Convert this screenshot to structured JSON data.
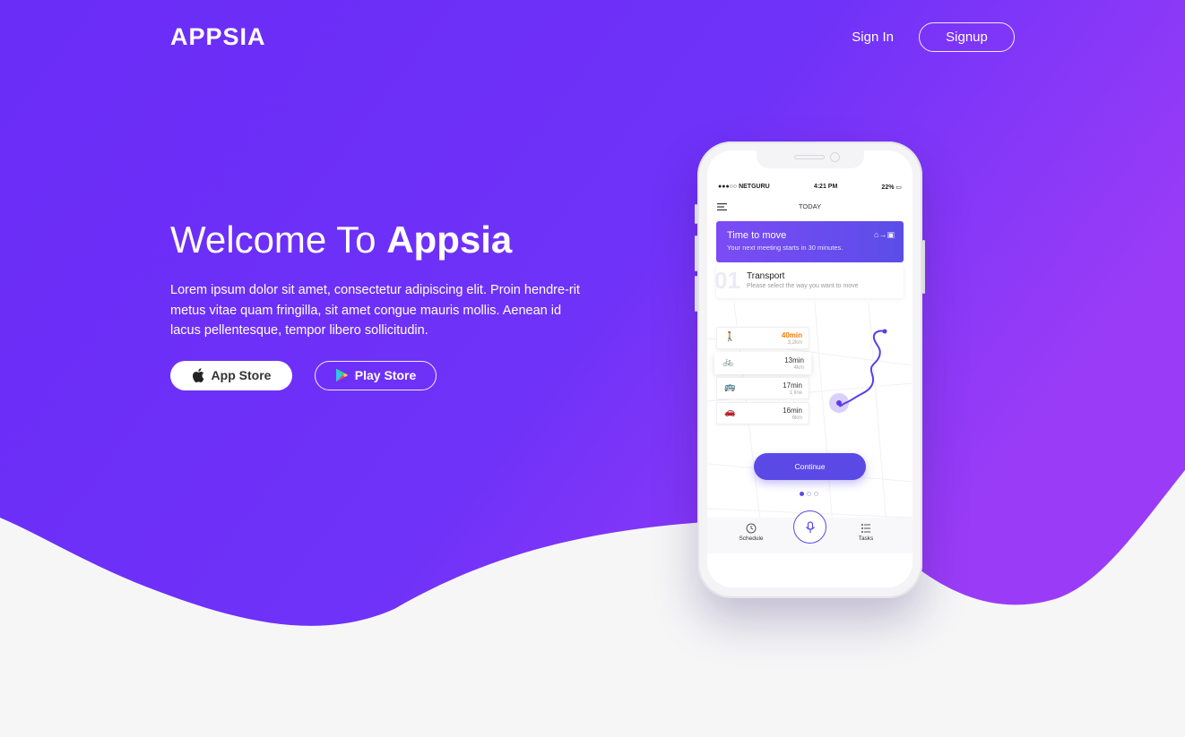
{
  "brand": {
    "logo": "APPSIA"
  },
  "nav": {
    "signin": "Sign In",
    "signup": "Signup"
  },
  "hero": {
    "title_prefix": "Welcome To ",
    "title_bold": "Appsia",
    "description": "Lorem ipsum dolor sit amet, consectetur adipiscing elit. Proin hendre-rit metus vitae quam fringilla, sit amet congue mauris mollis. Aenean id lacus pellentesque, tempor libero sollicitudin.",
    "app_store": "App Store",
    "play_store": "Play Store"
  },
  "phone": {
    "status": {
      "carrier": "●●●○○ NETGURU",
      "time": "4:21 PM",
      "battery": "22%"
    },
    "header": "TODAY",
    "move_card": {
      "title": "Time to move",
      "subtitle": "Your next meeting starts in 30 minutes."
    },
    "transport_card": {
      "number": "01",
      "title": "Transport",
      "subtitle": "Please select the way you want to move"
    },
    "modes": [
      {
        "icon": "walk-icon",
        "glyph": "🚶",
        "time": "40min",
        "dist": "3,2km",
        "highlight": true
      },
      {
        "icon": "bike-icon",
        "glyph": "🚲",
        "time": "13min",
        "dist": "4km",
        "highlight": false
      },
      {
        "icon": "bus-icon",
        "glyph": "🚌",
        "time": "17min",
        "dist": "1 line",
        "highlight": false
      },
      {
        "icon": "car-icon",
        "glyph": "🚗",
        "time": "16min",
        "dist": "6km",
        "highlight": false
      }
    ],
    "continue": "Continue",
    "tabs": {
      "schedule": "Schedule",
      "tasks": "Tasks"
    }
  },
  "colors": {
    "hero_start": "#6a2cf5",
    "hero_end": "#9a3cf7",
    "accent": "#5b49e6",
    "highlight": "#ff7a00"
  }
}
